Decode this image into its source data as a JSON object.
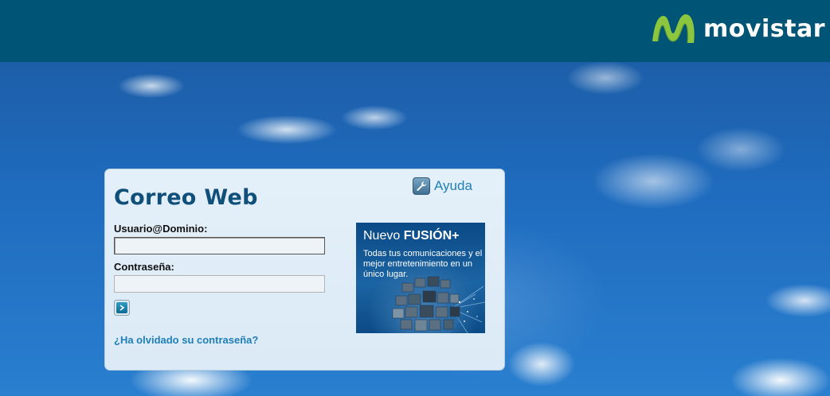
{
  "header": {
    "brand_name": "movistar",
    "brand_colors": {
      "bar": "#005475",
      "logo_green": "#8cc63f"
    }
  },
  "login": {
    "title": "Correo Web",
    "help_label": "Ayuda",
    "username_label": "Usuario@Dominio:",
    "username_value": "",
    "password_label": "Contraseña:",
    "password_value": "",
    "submit_icon": "arrow-right-icon",
    "forgot_password_label": "¿Ha olvidado su contraseña?"
  },
  "promo": {
    "title_regular": "Nuevo",
    "title_bold": "FUSIÓN+",
    "body": "Todas tus comunicaciones y el mejor entretenimiento en un único lugar."
  }
}
